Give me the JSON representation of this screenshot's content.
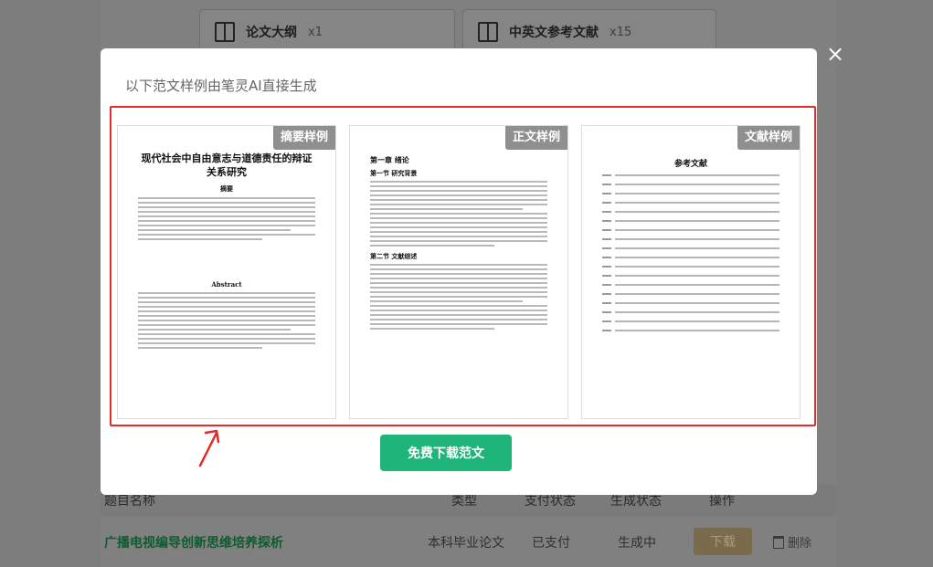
{
  "background": {
    "features": [
      {
        "name": "论文大纲",
        "count": "x1",
        "icon": "book-open-icon"
      },
      {
        "name": "中英文参考文献",
        "count": "x15",
        "icon": "edit-document-icon"
      }
    ],
    "table": {
      "headers": [
        "题目名称",
        "类型",
        "支付状态",
        "生成状态",
        "操作"
      ],
      "rows": [
        {
          "title": "广播电视编导创新思维培养探析",
          "type": "本科毕业论文",
          "pay": "已支付",
          "gen": "生成中",
          "download": "下载",
          "delete": "删除"
        }
      ]
    }
  },
  "modal": {
    "title": "以下范文样例由笔灵AI直接生成",
    "samples": [
      {
        "badge": "摘要样例",
        "doc_title": "现代社会中自由意志与道德责任的辩证关系研究",
        "abstract_cn": "摘要",
        "abstract_en": "Abstract"
      },
      {
        "badge": "正文样例",
        "chapter": "第一章 绪论",
        "section1": "第一节 研究背景",
        "section2": "第二节 文献综述"
      },
      {
        "badge": "文献样例",
        "ref_title": "参考文献"
      }
    ],
    "download_label": "免费下载范文",
    "close_label": "×"
  },
  "colors": {
    "accent": "#1fb57a",
    "highlight": "#e32b2b",
    "badge": "#8f8f8f"
  }
}
